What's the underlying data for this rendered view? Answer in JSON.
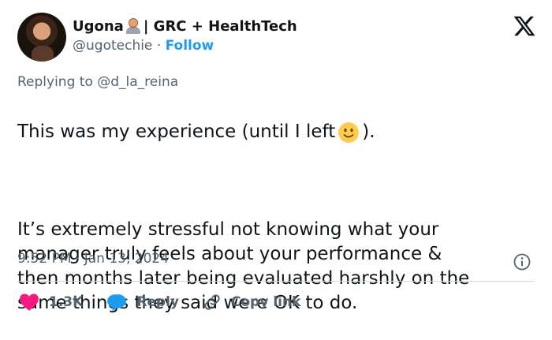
{
  "author": {
    "name": "Ugona",
    "name_suffix": "| GRC + HealthTech",
    "handle": "@ugotechie",
    "separator": "·",
    "follow_label": "Follow"
  },
  "tweet": {
    "replying_to": "Replying to @d_la_reina",
    "line1_before": "This was my experience (until I left",
    "line1_after": ").",
    "paragraph2": "It’s extremely stressful not knowing what your\nmanager truly feels about your performance &\nthen months later being evaluated harshly on the\nsame things they said were OK to do.",
    "timestamp": "9:52 PM · Jan 13, 2024"
  },
  "actions": {
    "likes": "1.3K",
    "reply_label": "Reply",
    "copy_link_label": "Copy link"
  },
  "colors": {
    "like": "#f91880",
    "reply": "#1d9bf0",
    "muted": "#536471",
    "text": "#0f1419"
  },
  "icons": [
    "x-logo-icon",
    "heart-icon",
    "reply-bubble-icon",
    "link-icon",
    "info-icon",
    "slightly-smiling-face-emoji",
    "woman-technologist-emoji"
  ]
}
